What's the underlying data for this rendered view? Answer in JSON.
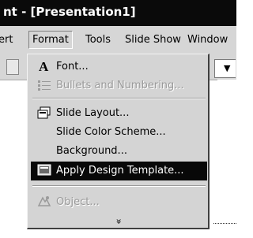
{
  "window": {
    "title": "nt - [Presentation1]"
  },
  "menubar": {
    "items": [
      "ert",
      "Format",
      "Tools",
      "Slide Show",
      "Window"
    ]
  },
  "menu": {
    "items": [
      {
        "label": "Font...",
        "icon": "font-icon",
        "disabled": false
      },
      {
        "label": "Bullets and Numbering...",
        "icon": "bullets-icon",
        "disabled": true
      },
      {
        "label": "Slide Layout...",
        "icon": "slide-layout-icon",
        "disabled": false
      },
      {
        "label": "Slide Color Scheme...",
        "icon": "",
        "disabled": false
      },
      {
        "label": "Background...",
        "icon": "",
        "disabled": false
      },
      {
        "label": "Apply Design Template...",
        "icon": "design-template-icon",
        "disabled": false,
        "selected": true
      },
      {
        "label": "Object...",
        "icon": "object-icon",
        "disabled": true
      }
    ],
    "more_glyph": "»"
  },
  "colors": {
    "selected_bg": "#080808",
    "menu_bg": "#d4d4d4",
    "title_bg": "#0a0a0a"
  }
}
